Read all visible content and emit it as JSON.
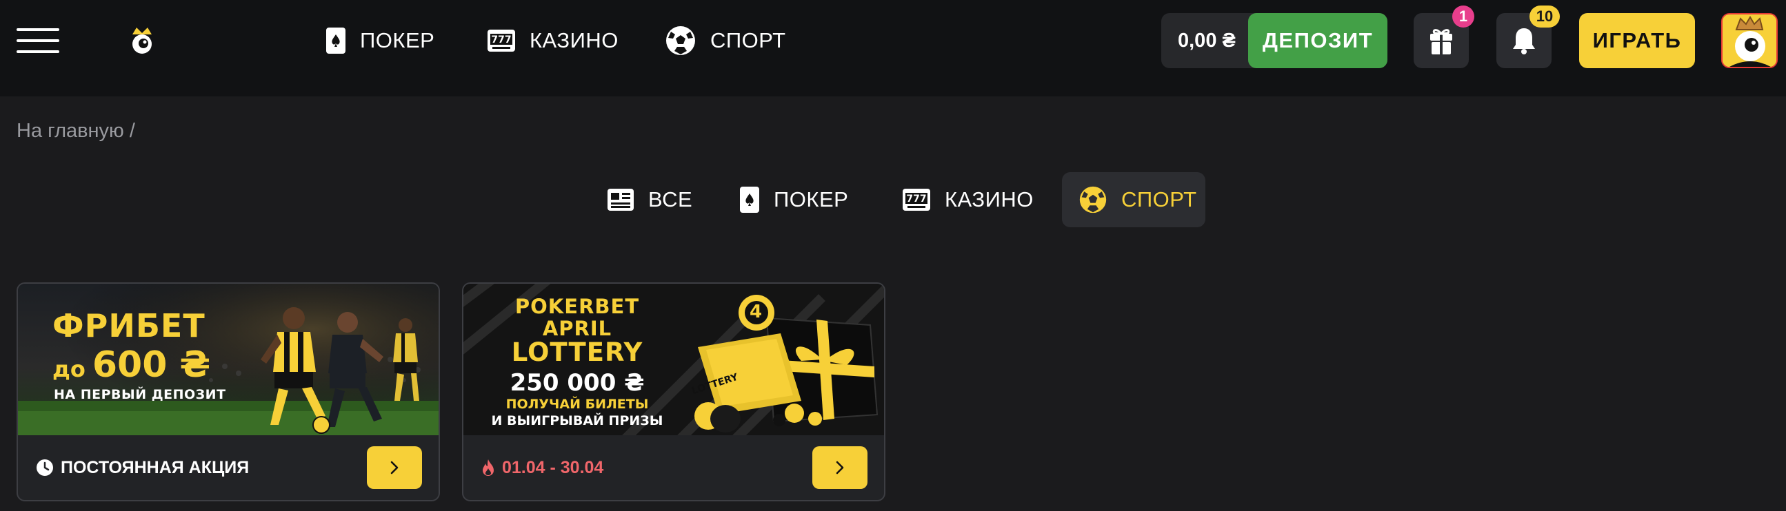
{
  "header": {
    "nav": [
      {
        "label": "ПОКЕР",
        "icon": "poker-card-icon"
      },
      {
        "label": "КАЗИНО",
        "icon": "slot-777-icon"
      },
      {
        "label": "СПОРТ",
        "icon": "soccer-ball-icon"
      }
    ],
    "balance": "0,00 ₴",
    "deposit_label": "ДЕПОЗИТ",
    "gift_count": "1",
    "notification_count": "10",
    "play_label": "ИГРАТЬ"
  },
  "breadcrumb": {
    "home": "На главную",
    "separator": "/"
  },
  "filters": {
    "tabs": [
      {
        "label": "ВСЕ",
        "icon": "news-icon"
      },
      {
        "label": "ПОКЕР",
        "icon": "poker-card-icon"
      },
      {
        "label": "КАЗИНО",
        "icon": "slot-777-icon"
      },
      {
        "label": "СПОРТ",
        "icon": "soccer-ball-icon",
        "active": true
      }
    ]
  },
  "promos": [
    {
      "banner": {
        "line1": "ФРИБЕТ",
        "line2_prefix": "до",
        "line2_amount": "600 ₴",
        "line3": "НА ПЕРВЫЙ ДЕПОЗИТ"
      },
      "footer_icon": "clock-icon",
      "footer_text": "ПОСТОЯННАЯ АКЦИЯ"
    },
    {
      "banner": {
        "line1": "POKERBET",
        "line2": "APRIL",
        "line3": "LOTTERY",
        "amount": "250 000 ₴",
        "sub1": "ПОЛУЧАЙ БИЛЕТЫ",
        "sub2": "И ВЫИГРЫВАЙ ПРИЗЫ",
        "ticket_label": "LOTTERY",
        "ball_number": "4"
      },
      "footer_icon": "fire-icon",
      "footer_text": "01.04 - 30.04"
    }
  ],
  "colors": {
    "accent_yellow": "#f7d038",
    "deposit_green": "#43a047",
    "header_bg": "#111214",
    "page_bg": "#1b1b1d",
    "date_red": "#f0666a"
  }
}
